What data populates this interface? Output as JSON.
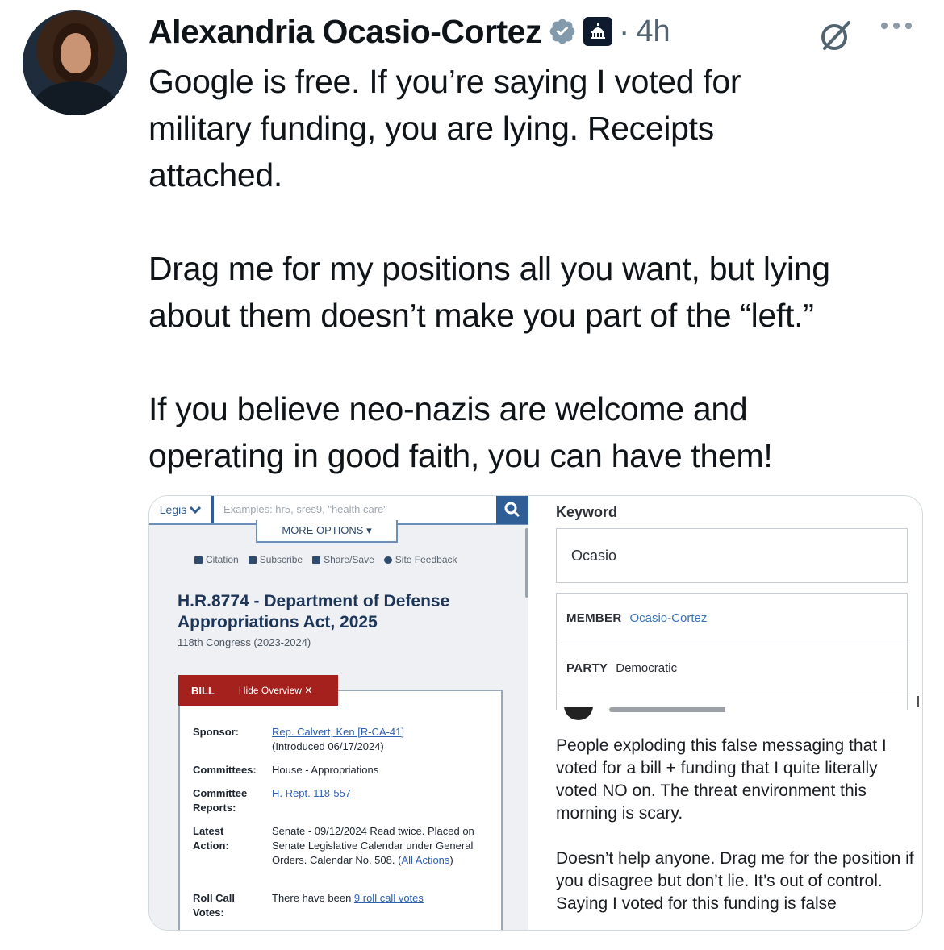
{
  "tweet": {
    "author_name": "Alexandria Ocasio-Cortez",
    "time_sep": "·",
    "time": "4h",
    "paragraphs": [
      [
        "Google is free. If you’re saying I voted for",
        "military funding, you are lying. Receipts",
        "attached."
      ],
      [
        "Drag me for my positions all you want, but lying",
        "about them doesn’t make you part of the “left.”"
      ],
      [
        "If you believe neo-nazis are welcome and",
        "operating in good faith, you can have them!"
      ]
    ],
    "icons": [
      "avatar",
      "verified-badge-icon",
      "affiliation-badge-icon",
      "grok-icon",
      "more-options-icon"
    ],
    "colors": {
      "verified": "#829aab",
      "muted": "#536471"
    }
  },
  "left_image": {
    "search": {
      "scope_label": "Legis",
      "placeholder": "Examples: hr5, sres9, \"health care\"",
      "more_options": "MORE OPTIONS ▾"
    },
    "toolbar": [
      "Citation",
      "Subscribe",
      "Share/Save",
      "Site Feedback"
    ],
    "bill_title": "H.R.8774 - Department of Defense Appropriations Act, 2025",
    "congress": "118th Congress (2023-2024)",
    "tab": {
      "label": "BILL",
      "hide": "Hide Overview ✕"
    },
    "overview": {
      "sponsor_label": "Sponsor:",
      "sponsor_link": "Rep. Calvert, Ken [R-CA-41]",
      "sponsor_note": "(Introduced 06/17/2024)",
      "committees_label": "Committees:",
      "committees_value": "House - Appropriations",
      "reports_label": "Committee Reports:",
      "reports_link": "H. Rept. 118-557",
      "latest_label": "Latest Action:",
      "latest_value": "Senate - 09/12/2024 Read twice. Placed on Senate Legislative Calendar under General Orders. Calendar No. 508.",
      "latest_link_open": "(",
      "latest_link": "All Actions",
      "latest_link_close": ")",
      "rollcall_label": "Roll Call Votes:",
      "rollcall_value": "There have been ",
      "rollcall_link": "9 roll call votes"
    }
  },
  "right_image": {
    "keyword_label": "Keyword",
    "keyword_value": "Ocasio",
    "member_key": "MEMBER",
    "member_value": "Ocasio-Cortez",
    "party_key": "PARTY",
    "party_value": "Democratic",
    "note_paragraphs": [
      "People exploding this false messaging that I voted for a bill + funding that I quite literally voted NO on. The threat environment this morning is scary.",
      "Doesn’t help anyone. Drag me for the position if you disagree but don’t lie. It’s out of control. Saying I voted for this funding is false"
    ]
  }
}
